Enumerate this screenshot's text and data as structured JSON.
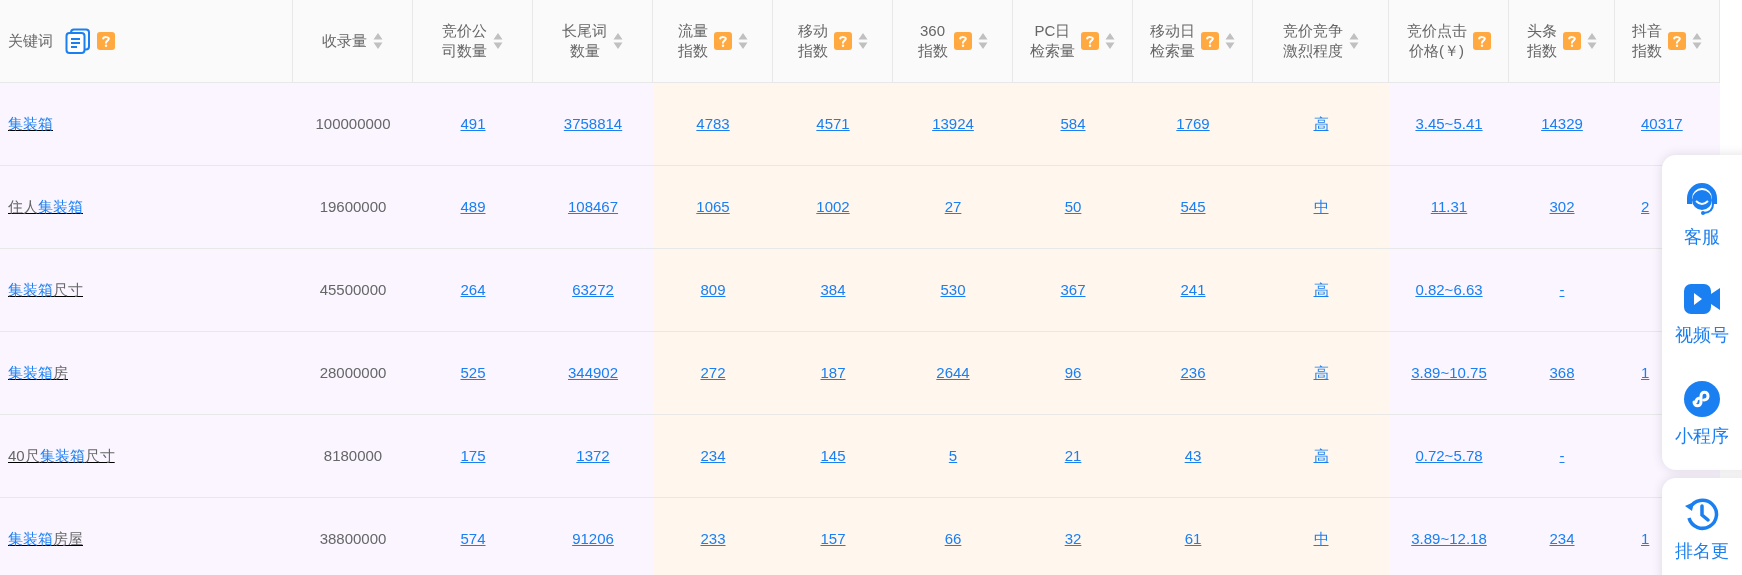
{
  "columns": [
    {
      "label_lines": [
        "关键词"
      ],
      "kind": "keyword",
      "color": "#faf5ff",
      "copy": true,
      "help": true,
      "sortable": false
    },
    {
      "label_lines": [
        "收录量"
      ],
      "kind": "plain",
      "color": "#faf5ff",
      "copy": false,
      "help": false,
      "sortable": true
    },
    {
      "label_lines": [
        "竞价公",
        "司数量"
      ],
      "kind": "link",
      "color": "#faf5ff",
      "copy": false,
      "help": false,
      "sortable": true
    },
    {
      "label_lines": [
        "长尾词",
        "数量"
      ],
      "kind": "link",
      "color": "#faf5ff",
      "copy": false,
      "help": false,
      "sortable": true
    },
    {
      "label_lines": [
        "流量",
        "指数"
      ],
      "kind": "link",
      "color": "#fff6ed",
      "copy": false,
      "help": true,
      "sortable": true
    },
    {
      "label_lines": [
        "移动",
        "指数"
      ],
      "kind": "link",
      "color": "#fff6ed",
      "copy": false,
      "help": true,
      "sortable": true
    },
    {
      "label_lines": [
        "360",
        "指数"
      ],
      "kind": "link",
      "color": "#fff6ed",
      "copy": false,
      "help": true,
      "sortable": true
    },
    {
      "label_lines": [
        "PC日",
        "检索量"
      ],
      "kind": "link",
      "color": "#fff6ed",
      "copy": false,
      "help": true,
      "sortable": true
    },
    {
      "label_lines": [
        "移动日",
        "检索量"
      ],
      "kind": "link",
      "color": "#fff6ed",
      "copy": false,
      "help": true,
      "sortable": true
    },
    {
      "label_lines": [
        "竞价竞争",
        "激烈程度"
      ],
      "kind": "link",
      "color": "#fff6ed",
      "copy": false,
      "help": false,
      "sortable": true
    },
    {
      "label_lines": [
        "竞价点击",
        "价格(￥)"
      ],
      "kind": "link",
      "color": "#faf5ff",
      "copy": false,
      "help": true,
      "sortable": false
    },
    {
      "label_lines": [
        "头条",
        "指数"
      ],
      "kind": "link",
      "color": "#faf5ff",
      "copy": false,
      "help": true,
      "sortable": true
    },
    {
      "label_lines": [
        "抖音",
        "指数"
      ],
      "kind": "link",
      "color": "#faf5ff",
      "copy": false,
      "help": true,
      "sortable": true
    }
  ],
  "rows": [
    {
      "keyword": [
        {
          "text": "集装箱",
          "highlight": true
        }
      ],
      "values": [
        "100000000",
        "491",
        "3758814",
        "4783",
        "4571",
        "13924",
        "584",
        "1769",
        "高",
        "3.45~5.41",
        "14329",
        "40317"
      ]
    },
    {
      "keyword": [
        {
          "text": "住人",
          "highlight": false
        },
        {
          "text": "集装箱",
          "highlight": true
        }
      ],
      "values": [
        "19600000",
        "489",
        "108467",
        "1065",
        "1002",
        "27",
        "50",
        "545",
        "中",
        "11.31",
        "302",
        "2"
      ]
    },
    {
      "keyword": [
        {
          "text": "集装箱",
          "highlight": true
        },
        {
          "text": "尺寸",
          "highlight": false
        }
      ],
      "values": [
        "45500000",
        "264",
        "63272",
        "809",
        "384",
        "530",
        "367",
        "241",
        "高",
        "0.82~6.63",
        "-"
      ]
    },
    {
      "keyword": [
        {
          "text": "集装箱",
          "highlight": true
        },
        {
          "text": "房",
          "highlight": false
        }
      ],
      "values": [
        "28000000",
        "525",
        "344902",
        "272",
        "187",
        "2644",
        "96",
        "236",
        "高",
        "3.89~10.75",
        "368",
        "1"
      ]
    },
    {
      "keyword": [
        {
          "text": "40尺",
          "highlight": false
        },
        {
          "text": "集装箱",
          "highlight": true
        },
        {
          "text": "尺寸",
          "highlight": false
        }
      ],
      "values": [
        "8180000",
        "175",
        "1372",
        "234",
        "145",
        "5",
        "21",
        "43",
        "高",
        "0.72~5.78",
        "-"
      ]
    },
    {
      "keyword": [
        {
          "text": "集装箱",
          "highlight": true
        },
        {
          "text": "房屋",
          "highlight": false
        }
      ],
      "values": [
        "38800000",
        "574",
        "91206",
        "233",
        "157",
        "66",
        "32",
        "61",
        "中",
        "3.89~12.18",
        "234",
        "1"
      ]
    }
  ],
  "side_panel": [
    {
      "kind": "service",
      "label": "客服"
    },
    {
      "kind": "video",
      "label": "视频号"
    },
    {
      "kind": "miniapp",
      "label": "小程序"
    }
  ],
  "side_panel_2": [
    {
      "kind": "history",
      "label": "排名更"
    }
  ]
}
